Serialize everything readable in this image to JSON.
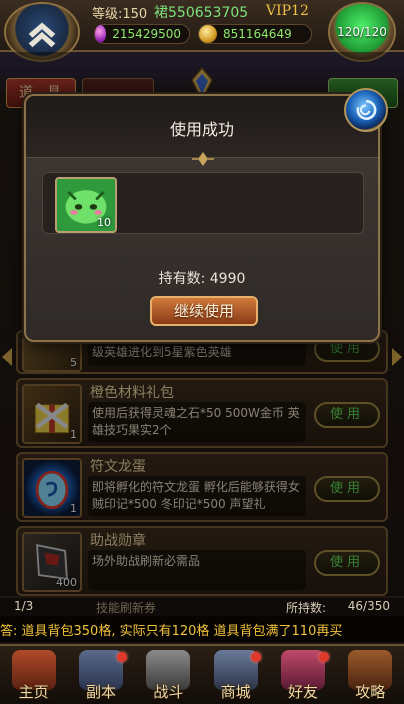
{
  "topbar": {
    "level_label": "等级:150",
    "clan_label": "裙550653705",
    "vip_label": "VIP12",
    "gems": "215429500",
    "gold": "851164649",
    "energy": "120/120"
  },
  "tabs": {
    "items_tab": "道具"
  },
  "modal": {
    "title": "使用成功",
    "reward_qty": "10",
    "hold_count": "持有数: 4990",
    "continue_label": "继续使用"
  },
  "items": [
    {
      "qty": "5",
      "desc": "级英雄进化到5星紫色英雄",
      "use": "使用"
    },
    {
      "name": "橙色材料礼包",
      "qty": "1",
      "desc": "使用后获得灵魂之石*50 500W金币 英雄技巧果实2个",
      "use": "使用"
    },
    {
      "name": "符文龙蛋",
      "qty": "1",
      "desc": "即将孵化的符文龙蛋 孵化后能够获得女贼印记*500 冬印记*500 声望礼",
      "use": "使用"
    },
    {
      "name": "助战勋章",
      "qty": "400",
      "desc": "场外助战刷新必需品",
      "use": "使用"
    }
  ],
  "pager": {
    "page": "1/3",
    "next_item": "技能刷新券",
    "hold_label": "所持数:",
    "capacity": "46/350"
  },
  "ticker": "答: 道具背包350格, 实际只有120格 道具背包满了110再买",
  "nav": [
    {
      "label": "主页",
      "name": "home"
    },
    {
      "label": "副本",
      "name": "dungeon"
    },
    {
      "label": "战斗",
      "name": "battle"
    },
    {
      "label": "商城",
      "name": "shop"
    },
    {
      "label": "好友",
      "name": "friends"
    },
    {
      "label": "攻略",
      "name": "guide"
    }
  ],
  "colors": {
    "accent_green": "#5fe05a",
    "gold_text": "#f2c23a",
    "button_orange": "#d07a3a"
  }
}
